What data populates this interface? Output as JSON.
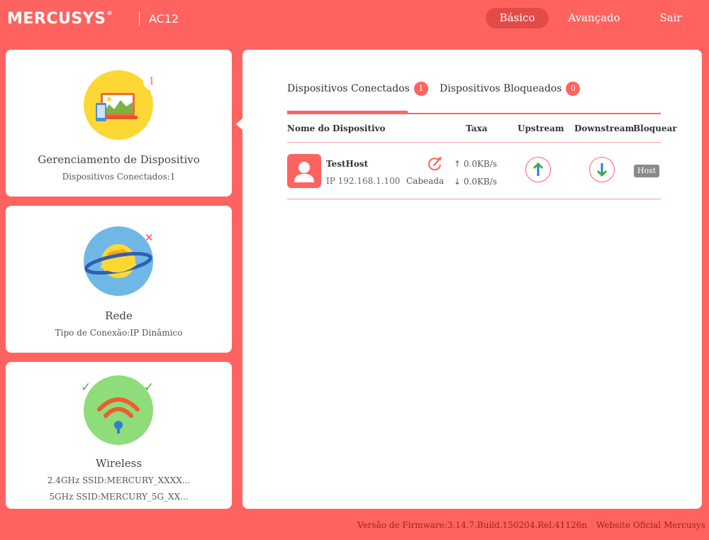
{
  "header": {
    "brand": "MERCUSYS",
    "brand_mark": "®",
    "model": "AC12",
    "nav": {
      "basic": "Básico",
      "advanced": "Avançado",
      "exit": "Sair"
    }
  },
  "sidebar": {
    "devices": {
      "title": "Gerenciamento de Dispositivo",
      "subtitle": "Dispositivos Conectados:1",
      "badge": "1"
    },
    "network": {
      "title": "Rede",
      "subtitle": "Tipo de Conexão:IP Dinâmico",
      "badge_icon": "close-icon"
    },
    "wireless": {
      "title": "Wireless",
      "ssid_24": "2.4GHz SSID:MERCURY_XXXX...",
      "ssid_5": "5GHz SSID:MERCURY_5G_XX..."
    }
  },
  "tabs": {
    "connected": {
      "label": "Dispositivos Conectados",
      "count": "1"
    },
    "blocked": {
      "label": "Dispositivos Bloqueados",
      "count": "0"
    }
  },
  "table": {
    "headers": {
      "name": "Nome do Dispositivo",
      "rate": "Taxa",
      "upstream": "Upstream",
      "downstream": "Downstream",
      "block": "Bloquear"
    },
    "rows": [
      {
        "name": "TestHost",
        "ip": "IP 192.168.1.100",
        "connection": "Cabeada",
        "rate_up": "0.0KB/s",
        "rate_down": "0.0KB/s",
        "block_label": "Host"
      }
    ]
  },
  "footer": {
    "firmware": "Versão de Firmware:3.14.7.Build.150204.Rel.41126n",
    "website": "Website Oficial Mercusys"
  },
  "colors": {
    "accent": "#fe6360",
    "accent_dark": "#e34b49",
    "footer_text": "#a3231f"
  }
}
